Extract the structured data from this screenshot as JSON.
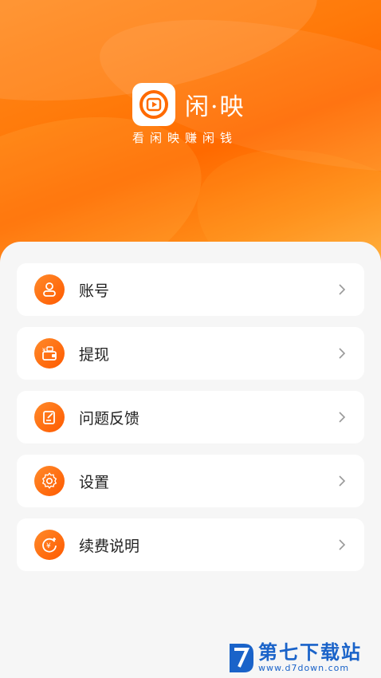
{
  "app": {
    "name": "闲·映",
    "slogan": "看闲映赚闲钱"
  },
  "colors": {
    "accent": "#ff6a00",
    "accent_light": "#ff8a2a",
    "card_bg": "#ffffff",
    "page_bg": "#f6f6f6"
  },
  "menu": {
    "items": [
      {
        "label": "账号",
        "icon": "user-icon"
      },
      {
        "label": "提现",
        "icon": "wallet-icon"
      },
      {
        "label": "问题反馈",
        "icon": "feedback-icon"
      },
      {
        "label": "设置",
        "icon": "gear-icon"
      },
      {
        "label": "续费说明",
        "icon": "yen-coin-icon"
      }
    ]
  },
  "watermark": {
    "name": "第七下载站",
    "url": "www.d7down.com"
  }
}
